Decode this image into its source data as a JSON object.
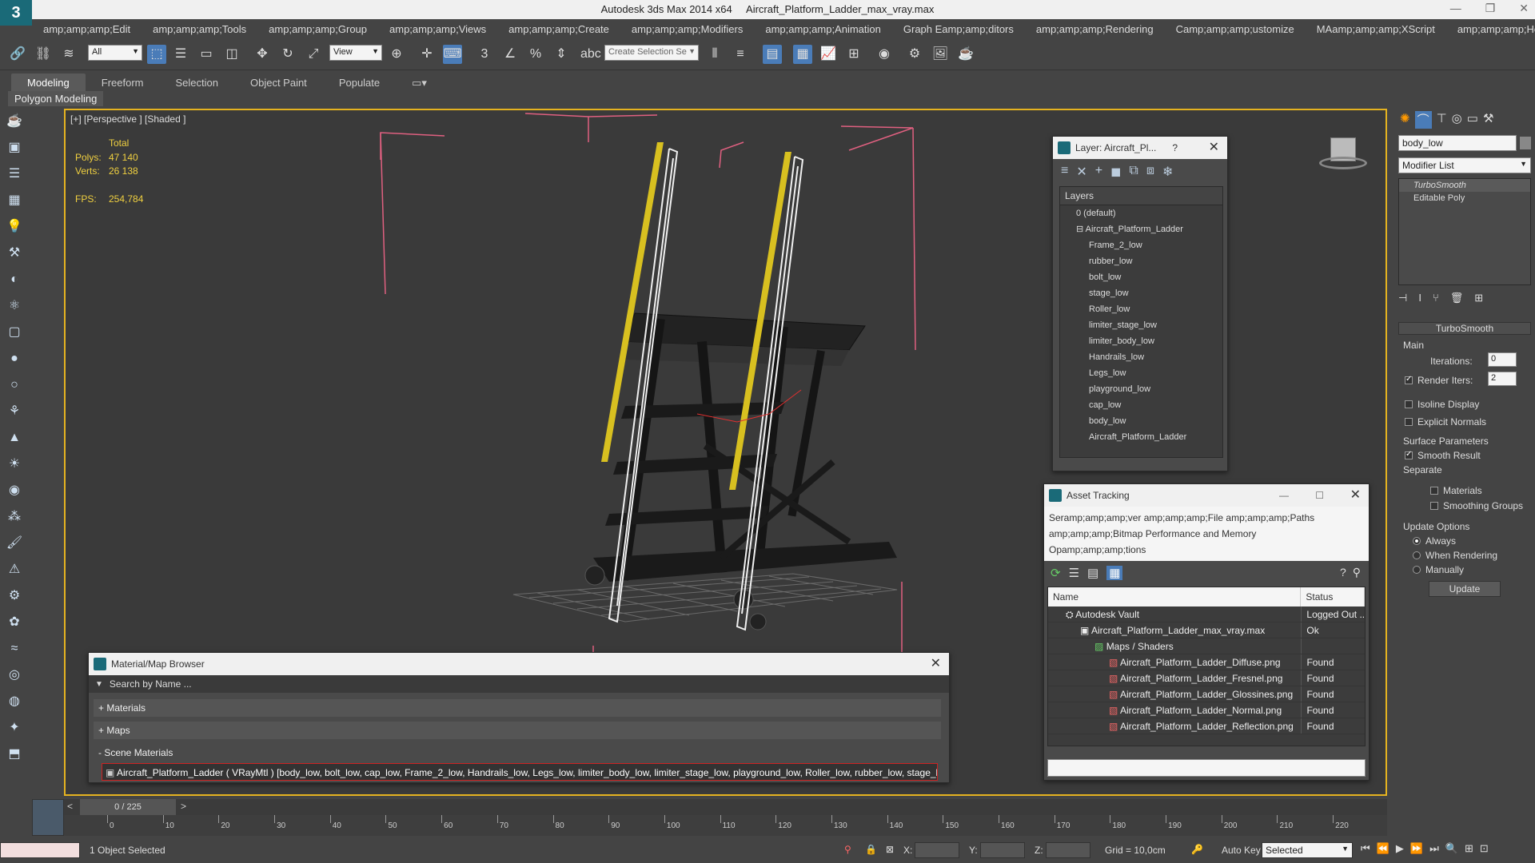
{
  "window": {
    "app_name": "Autodesk 3ds Max  2014 x64",
    "file_name": "Aircraft_Platform_Ladder_max_vray.max"
  },
  "menu": [
    "amp;amp;amp;Edit",
    "amp;amp;amp;Tools",
    "amp;amp;amp;Group",
    "amp;amp;amp;Views",
    "amp;amp;amp;Create",
    "amp;amp;amp;Modifiers",
    "amp;amp;amp;Animation",
    "Graph Eamp;amp;ditors",
    "amp;amp;amp;Rendering",
    "Camp;amp;amp;ustomize",
    "MAamp;amp;amp;XScript",
    "amp;amp;amp;Help"
  ],
  "toolbar": {
    "filter_select": "All",
    "refcoord_select": "View",
    "selection_set_placeholder": "Create Selection Se"
  },
  "ribbon": {
    "tabs": [
      "Modeling",
      "Freeform",
      "Selection",
      "Object Paint",
      "Populate"
    ],
    "sub_label": "Polygon Modeling"
  },
  "viewport": {
    "label": "[+] [Perspective ] [Shaded ]",
    "total_label": "Total",
    "polys_label": "Polys:",
    "polys_value": "47 140",
    "verts_label": "Verts:",
    "verts_value": "26 138",
    "fps_label": "FPS:",
    "fps_value": "254,784"
  },
  "layer_panel": {
    "title": "Layer: Aircraft_Pl...",
    "help": "?",
    "header": "Layers",
    "rows": [
      {
        "name": "0 (default)",
        "indent": 0
      },
      {
        "name": "Aircraft_Platform_Ladder",
        "indent": 0
      },
      {
        "name": "Frame_2_low",
        "indent": 1
      },
      {
        "name": "rubber_low",
        "indent": 1
      },
      {
        "name": "bolt_low",
        "indent": 1
      },
      {
        "name": "stage_low",
        "indent": 1
      },
      {
        "name": "Roller_low",
        "indent": 1
      },
      {
        "name": "limiter_stage_low",
        "indent": 1
      },
      {
        "name": "limiter_body_low",
        "indent": 1
      },
      {
        "name": "Handrails_low",
        "indent": 1
      },
      {
        "name": "Legs_low",
        "indent": 1
      },
      {
        "name": "playground_low",
        "indent": 1
      },
      {
        "name": "cap_low",
        "indent": 1
      },
      {
        "name": "body_low",
        "indent": 1
      },
      {
        "name": "Aircraft_Platform_Ladder",
        "indent": 1
      }
    ]
  },
  "asset_panel": {
    "title": "Asset Tracking",
    "menu_line1": "Seramp;amp;amp;ver    amp;amp;amp;File    amp;amp;amp;Paths",
    "menu_line2": "amp;amp;amp;Bitmap Performance and Memory",
    "menu_line3": "Opamp;amp;amp;tions",
    "col_name": "Name",
    "col_status": "Status",
    "rows": [
      {
        "name": "Autodesk Vault",
        "status": "Logged Out ...",
        "indent": 1
      },
      {
        "name": "Aircraft_Platform_Ladder_max_vray.max",
        "status": "Ok",
        "indent": 2
      },
      {
        "name": "Maps / Shaders",
        "status": "",
        "indent": 3
      },
      {
        "name": "Aircraft_Platform_Ladder_Diffuse.png",
        "status": "Found",
        "indent": 4
      },
      {
        "name": "Aircraft_Platform_Ladder_Fresnel.png",
        "status": "Found",
        "indent": 4
      },
      {
        "name": "Aircraft_Platform_Ladder_Glossines.png",
        "status": "Found",
        "indent": 4
      },
      {
        "name": "Aircraft_Platform_Ladder_Normal.png",
        "status": "Found",
        "indent": 4
      },
      {
        "name": "Aircraft_Platform_Ladder_Reflection.png",
        "status": "Found",
        "indent": 4
      }
    ]
  },
  "material_browser": {
    "title": "Material/Map Browser",
    "search_placeholder": "Search by Name ...",
    "materials": "+ Materials",
    "maps": "+ Maps",
    "scene_materials": "- Scene Materials",
    "scene_item": "Aircraft_Platform_Ladder ( VRayMtl ) [body_low, bolt_low, cap_low, Frame_2_low, Handrails_low, Legs_low, limiter_body_low, limiter_stage_low, playground_low, Roller_low, rubber_low, stage_low]"
  },
  "command_panel": {
    "object_name": "body_low",
    "modifier_list": "Modifier List",
    "stack": [
      "TurboSmooth",
      "Editable Poly"
    ],
    "rollout_title": "TurboSmooth",
    "main_label": "Main",
    "iterations_label": "Iterations:",
    "iterations_value": "0",
    "render_iters_label": "Render Iters:",
    "render_iters_value": "2",
    "isoline_label": "Isoline Display",
    "explicit_normals_label": "Explicit Normals",
    "surface_params_label": "Surface Parameters",
    "smooth_result_label": "Smooth Result",
    "separate_label": "Separate",
    "materials_label": "Materials",
    "smoothing_groups_label": "Smoothing Groups",
    "update_options_label": "Update Options",
    "always_label": "Always",
    "when_rendering_label": "When Rendering",
    "manually_label": "Manually",
    "update_button": "Update"
  },
  "timeline": {
    "frame_display": "0 / 225",
    "ticks": [
      "0",
      "10",
      "20",
      "30",
      "40",
      "50",
      "60",
      "70",
      "80",
      "90",
      "100",
      "110",
      "120",
      "130",
      "140",
      "150",
      "160",
      "170",
      "180",
      "190",
      "200",
      "210",
      "220"
    ]
  },
  "status": {
    "selection": "1 Object Selected",
    "x_label": "X:",
    "y_label": "Y:",
    "z_label": "Z:",
    "grid": "Grid = 10,0cm",
    "auto_key": "Auto Key",
    "selected_dropdown": "Selected"
  },
  "colors": {
    "ui_bg": "#444444",
    "viewport_bg": "#3a3a3a",
    "active_border": "#e5b320",
    "stat_text": "#f0d040",
    "accent_blue": "#4a7cb8",
    "ladder_yellow": "#d8c020"
  }
}
